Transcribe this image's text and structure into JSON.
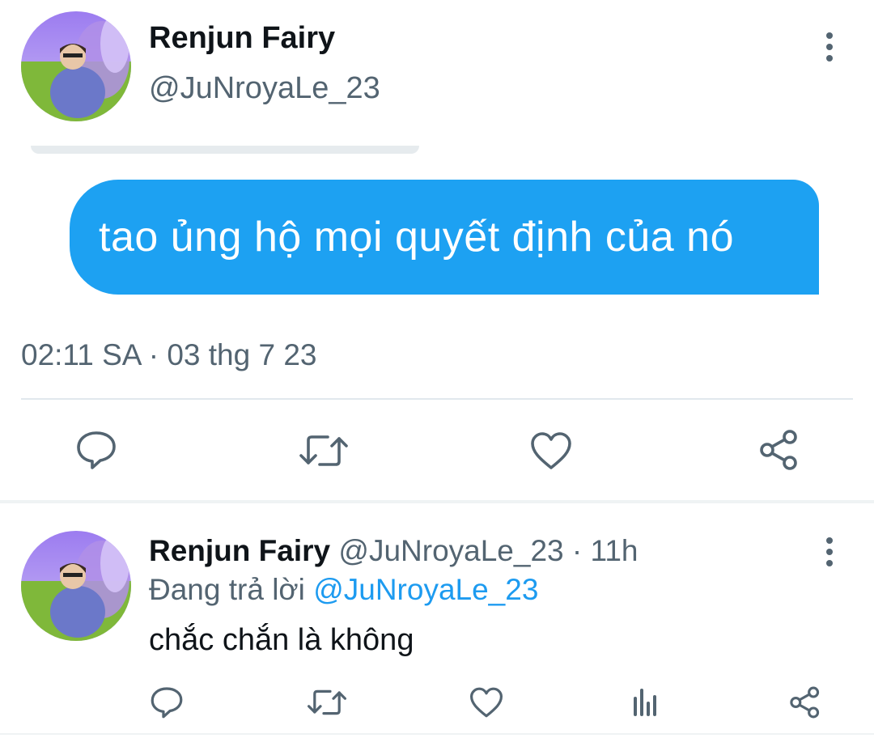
{
  "main_tweet": {
    "display_name": "Renjun Fairy",
    "handle": "@JuNroyaLe_23",
    "image_text": "tao ủng hộ mọi quyết định của nó",
    "timestamp": "02:11 SA · 03 thg 7 23",
    "actions": [
      "reply-icon",
      "retweet-icon",
      "like-icon",
      "share-icon"
    ]
  },
  "reply_tweet": {
    "display_name": "Renjun Fairy",
    "handle": "@JuNroyaLe_23",
    "separator": "·",
    "time_ago": "11h",
    "replying_prefix": "Đang trả lời",
    "replying_to": "@JuNroyaLe_23",
    "text": "chắc chắn là không",
    "actions": [
      "reply-icon",
      "retweet-icon",
      "like-icon",
      "analytics-icon",
      "share-icon"
    ]
  },
  "colors": {
    "accent": "#1d9bf0",
    "bubble": "#1da1f2",
    "secondary_text": "#536471",
    "primary_text": "#0f1419",
    "icon": "#536471"
  }
}
